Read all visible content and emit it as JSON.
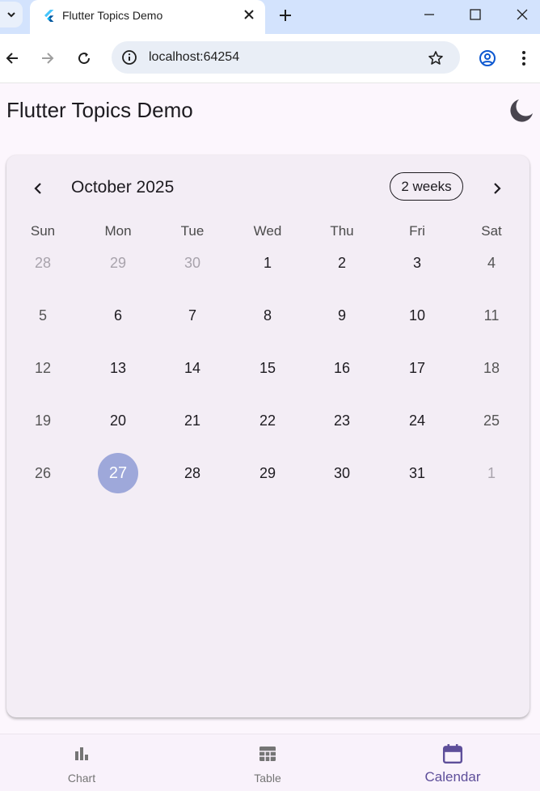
{
  "browser": {
    "tab_title": "Flutter Topics Demo",
    "url": "localhost:64254"
  },
  "app": {
    "title": "Flutter Topics Demo"
  },
  "calendar": {
    "month_label": "October 2025",
    "format_button": "2 weeks",
    "days_of_week": [
      "Sun",
      "Mon",
      "Tue",
      "Wed",
      "Thu",
      "Fri",
      "Sat"
    ],
    "weeks": [
      [
        "28",
        "29",
        "30",
        "1",
        "2",
        "3",
        "4"
      ],
      [
        "5",
        "6",
        "7",
        "8",
        "9",
        "10",
        "11"
      ],
      [
        "12",
        "13",
        "14",
        "15",
        "16",
        "17",
        "18"
      ],
      [
        "19",
        "20",
        "21",
        "22",
        "23",
        "24",
        "25"
      ],
      [
        "26",
        "27",
        "28",
        "29",
        "30",
        "31",
        "1"
      ]
    ],
    "selected_day": "27",
    "colors": {
      "selected": "#9ea8da",
      "outside_month": "#a8a3ac"
    }
  },
  "bottom_nav": {
    "items": [
      {
        "label": "Chart",
        "icon": "bar-chart-icon"
      },
      {
        "label": "Table",
        "icon": "table-icon"
      },
      {
        "label": "Calendar",
        "icon": "calendar-icon",
        "active": true
      }
    ],
    "colors": {
      "active": "#5e4f9a",
      "inactive": "#757575"
    }
  }
}
